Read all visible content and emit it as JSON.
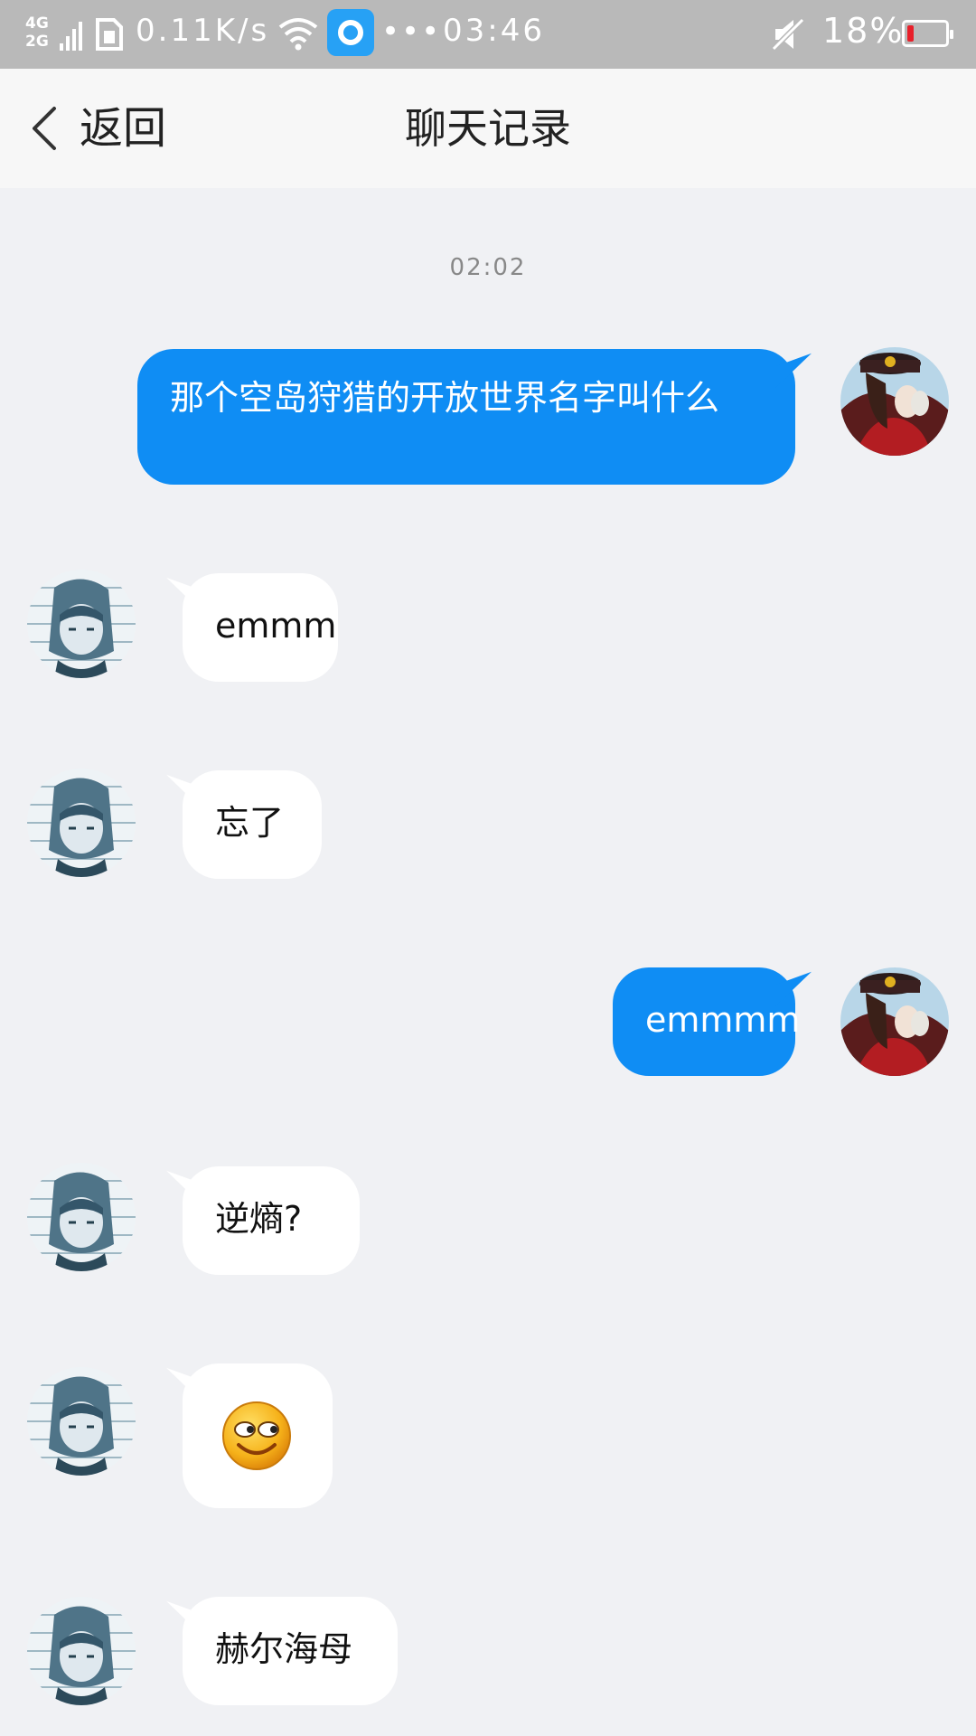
{
  "status_bar": {
    "network_top": "4G",
    "network_bottom": "2G",
    "speed": "0.11K/s",
    "more": "•••",
    "time": "03:46",
    "battery_percent": "18%",
    "battery_level": 0.18,
    "battery_color": "#e8202a"
  },
  "header": {
    "back_label": "返回",
    "title": "聊天记录"
  },
  "chat": {
    "timestamp": "02:02",
    "accent_color": "#0f8df4",
    "messages": [
      {
        "direction": "outgoing",
        "text": "那个空岛狩猎的开放世界名字叫什么"
      },
      {
        "direction": "incoming",
        "text": "emmm"
      },
      {
        "direction": "incoming",
        "text": "忘了"
      },
      {
        "direction": "outgoing",
        "text": "emmmm"
      },
      {
        "direction": "incoming",
        "text": "逆熵?"
      },
      {
        "direction": "incoming",
        "type": "emoji",
        "icon": "side-eye-smile-emoji"
      },
      {
        "direction": "incoming",
        "text": "赫尔海母"
      }
    ]
  }
}
